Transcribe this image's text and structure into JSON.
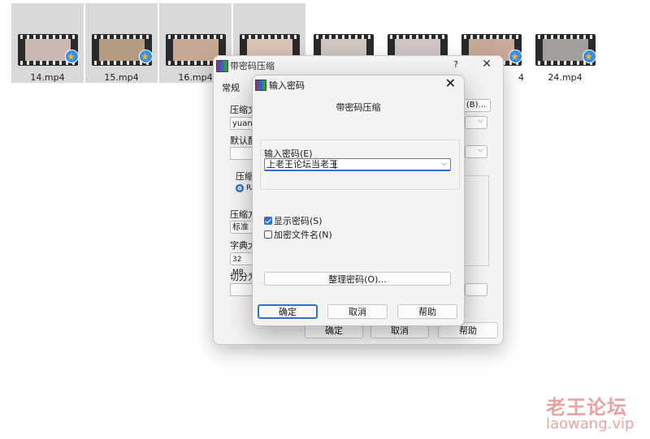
{
  "files": [
    {
      "label": "14.mp4",
      "selected": true,
      "frame": "#c9b8b4"
    },
    {
      "label": "15.mp4",
      "selected": true,
      "frame": "#b59a83"
    },
    {
      "label": "16.mp4",
      "selected": true,
      "frame": "#c5a995"
    },
    {
      "label": "",
      "selected": true,
      "frame": "#d9c3b5"
    },
    {
      "label": "",
      "selected": false,
      "frame": "#d0c5c0"
    },
    {
      "label": "",
      "selected": false,
      "frame": "#cfc6c4"
    },
    {
      "label": "4",
      "selected": false,
      "frame": "#c9a99a"
    },
    {
      "label": "24.mp4",
      "selected": false,
      "frame": "#a39e9a"
    }
  ],
  "back_dialog": {
    "title": "带密码压缩",
    "help": "?",
    "close": "✕",
    "tab_general": "常规",
    "compress_label": "压缩文",
    "compress_value": "yuanlil",
    "browse_btn": "(B)...",
    "default_label": "默认配",
    "format_label": "压缩",
    "format_rar": "RA",
    "method_label": "压缩方",
    "method_value": "标准",
    "dict_label": "字典大",
    "dict_value": "32 MB",
    "split_label": "切分为",
    "right_paren": ")",
    "ok": "确定",
    "cancel": "取消",
    "help_btn": "帮助"
  },
  "dialog": {
    "title": "输入密码",
    "close": "✕",
    "heading": "带密码压缩",
    "password_label": "输入密码(E)",
    "password_value": "上老王论坛当老王",
    "show_password": {
      "label": "显示密码(S)",
      "checked": true
    },
    "encrypt_filenames": {
      "label": "加密文件名(N)",
      "checked": false
    },
    "organize_btn": "整理密码(O)...",
    "ok": "确定",
    "cancel": "取消",
    "help": "帮助"
  },
  "watermark": {
    "cn": "老王论坛",
    "en": "laowang.vip"
  },
  "colors": {
    "accent": "#2f6fcf",
    "watermark": "#e8a3a3"
  }
}
